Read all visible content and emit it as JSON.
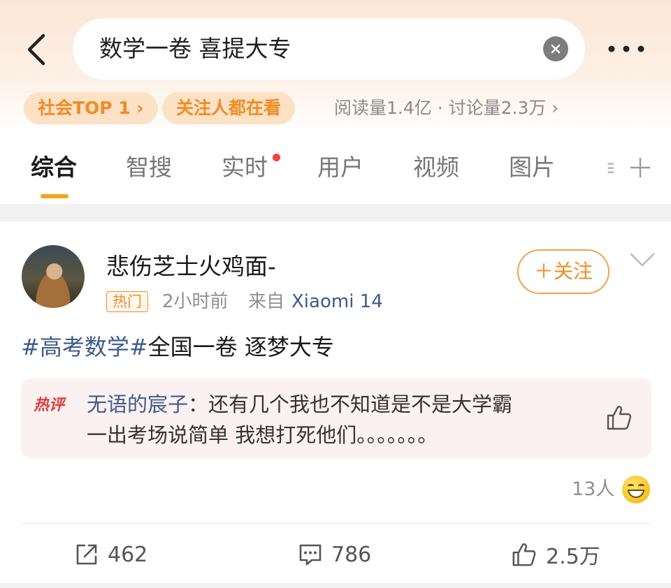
{
  "header": {
    "search_query": "数学一卷 喜提大专",
    "icons": {
      "back": "back-arrow-icon",
      "clear": "clear-icon",
      "more": "more-icon"
    }
  },
  "badges": {
    "rank": "社会TOP 1 ›",
    "following": "关注人都在看"
  },
  "stats": "阅读量1.4亿 · 讨论量2.3万 ›",
  "tabs": [
    {
      "label": "综合",
      "active": true
    },
    {
      "label": "智搜"
    },
    {
      "label": "实时",
      "has_dot": true
    },
    {
      "label": "用户"
    },
    {
      "label": "视频"
    },
    {
      "label": "图片"
    }
  ],
  "post": {
    "username": "悲伤芝士火鸡面-",
    "hot_tag": "热门",
    "time": "2小时前",
    "source_prefix": "来自",
    "device": "Xiaomi 14",
    "follow_label": "＋关注",
    "topic": "#高考数学#",
    "body_rest": "全国一卷 逐梦大专",
    "hot_comment": {
      "tag": "热评",
      "author": "无语的宸子",
      "line1_rest": "：还有几个我也不知道是不是大学霸",
      "line2": "一出考场说简单 我想打死他们。。。。。。。"
    },
    "reactors_count": "13人",
    "actions": {
      "share": "462",
      "comment": "786",
      "like": "2.5万"
    }
  },
  "colors": {
    "accent_orange": "#f08c25",
    "link_blue": "#3e5a8c",
    "hot_red": "#e23a3a",
    "tab_indicator": "#f7a21c"
  }
}
